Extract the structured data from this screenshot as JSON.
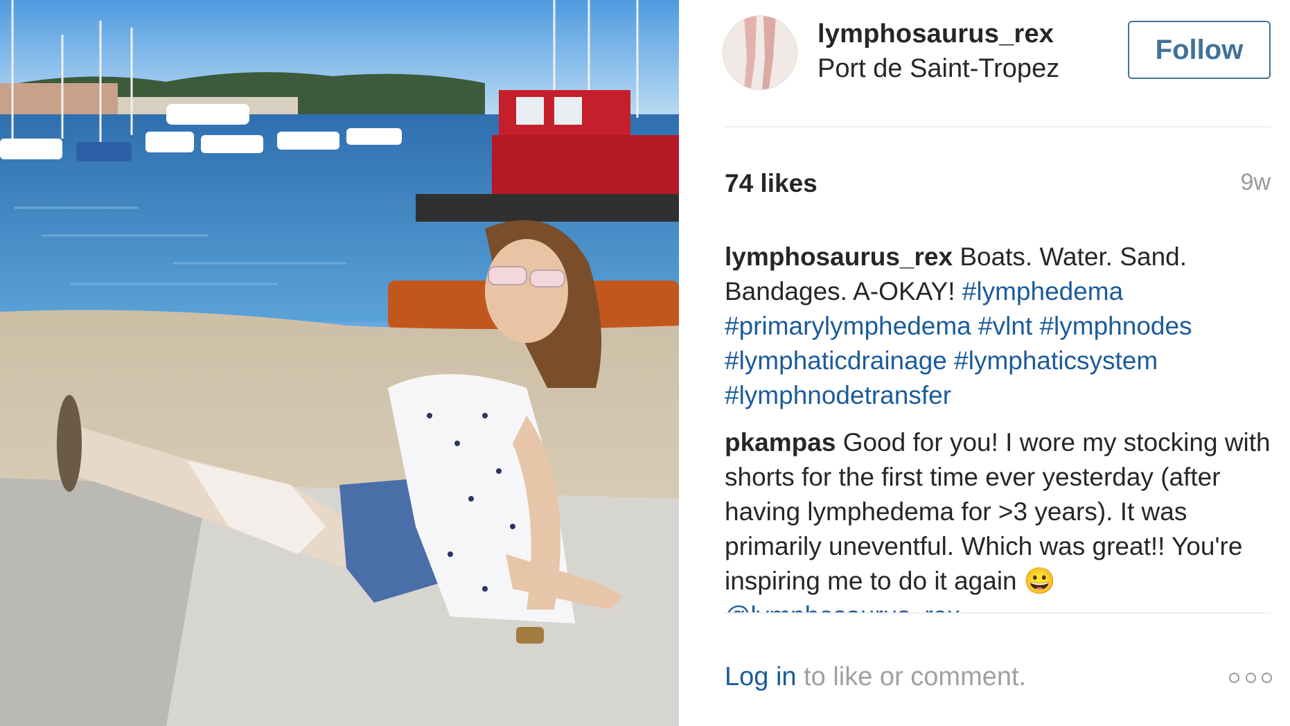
{
  "post": {
    "username": "lymphosaurus_rex",
    "location": "Port de Saint-Tropez",
    "follow_label": "Follow",
    "likes": "74 likes",
    "time_ago": "9w"
  },
  "caption": {
    "author": "lymphosaurus_rex",
    "text": "Boats. Water. Sand. Bandages. A-OKAY!",
    "hashtags": [
      "#lymphedema",
      "#primarylymphedema",
      "#vlnt",
      "#lymphnodes",
      "#lymphaticdrainage",
      "#lymphaticsystem",
      "#lymphnodetransfer"
    ]
  },
  "comment": {
    "author": "pkampas",
    "text": "Good for you! I wore my stocking with shorts for the first time ever yesterday (after having lymphedema for >3 years). It was primarily uneventful. Which was great!! You're inspiring me to do it again",
    "emoji": "😀",
    "mention": "@lymphosaurus_rex"
  },
  "footer": {
    "login_label": "Log in",
    "prompt": "to like or comment."
  },
  "icons": {
    "more": "more-options-icon"
  },
  "colors": {
    "link": "#1b5b9a",
    "follow": "#3f729b",
    "muted": "#999999"
  }
}
